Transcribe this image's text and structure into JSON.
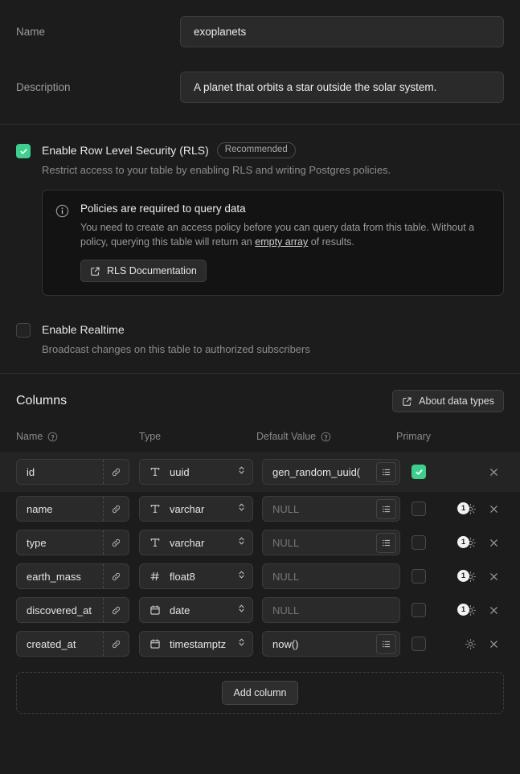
{
  "form": {
    "name_label": "Name",
    "name_value": "exoplanets",
    "description_label": "Description",
    "description_value": "A planet that orbits a star outside the solar system."
  },
  "rls": {
    "title": "Enable Row Level Security (RLS)",
    "badge": "Recommended",
    "description": "Restrict access to your table by enabling RLS and writing Postgres policies.",
    "checked": true,
    "alert": {
      "icon": "info-icon",
      "title": "Policies are required to query data",
      "body_before": "You need to create an access policy before you can query data from this table. Without a policy, querying this table will return an ",
      "body_link": "empty array",
      "body_after": " of results.",
      "button_label": "RLS Documentation",
      "button_icon": "external-link-icon"
    }
  },
  "realtime": {
    "title": "Enable Realtime",
    "description": "Broadcast changes on this table to authorized subscribers",
    "checked": false
  },
  "columns": {
    "title": "Columns",
    "about_label": "About data types",
    "about_icon": "external-link-icon",
    "headers": {
      "name": "Name",
      "type": "Type",
      "default": "Default Value",
      "primary": "Primary"
    },
    "add_label": "Add column",
    "rows": [
      {
        "name": "id",
        "type": "uuid",
        "type_icon": "text-type-icon",
        "default": "gen_random_uuid(",
        "default_is_null": false,
        "has_list_button": true,
        "primary": true,
        "highlighted": true,
        "has_gear": false,
        "gear_count": null
      },
      {
        "name": "name",
        "type": "varchar",
        "type_icon": "text-type-icon",
        "default": "NULL",
        "default_is_null": true,
        "has_list_button": true,
        "primary": false,
        "highlighted": false,
        "has_gear": true,
        "gear_count": "1"
      },
      {
        "name": "type",
        "type": "varchar",
        "type_icon": "text-type-icon",
        "default": "NULL",
        "default_is_null": true,
        "has_list_button": true,
        "primary": false,
        "highlighted": false,
        "has_gear": true,
        "gear_count": "1"
      },
      {
        "name": "earth_mass",
        "type": "float8",
        "type_icon": "number-type-icon",
        "default": "NULL",
        "default_is_null": true,
        "has_list_button": false,
        "primary": false,
        "highlighted": false,
        "has_gear": true,
        "gear_count": "1"
      },
      {
        "name": "discovered_at",
        "type": "date",
        "type_icon": "date-type-icon",
        "default": "NULL",
        "default_is_null": true,
        "has_list_button": false,
        "primary": false,
        "highlighted": false,
        "has_gear": true,
        "gear_count": "1"
      },
      {
        "name": "created_at",
        "type": "timestamptz",
        "type_icon": "date-type-icon",
        "default": "now()",
        "default_is_null": false,
        "has_list_button": true,
        "primary": false,
        "highlighted": false,
        "has_gear": true,
        "gear_count": null
      }
    ]
  },
  "colors": {
    "accent_green": "#3ecf8e",
    "background": "#1c1c1c",
    "panel": "#2a2a2a",
    "alert_bg": "#131313"
  }
}
